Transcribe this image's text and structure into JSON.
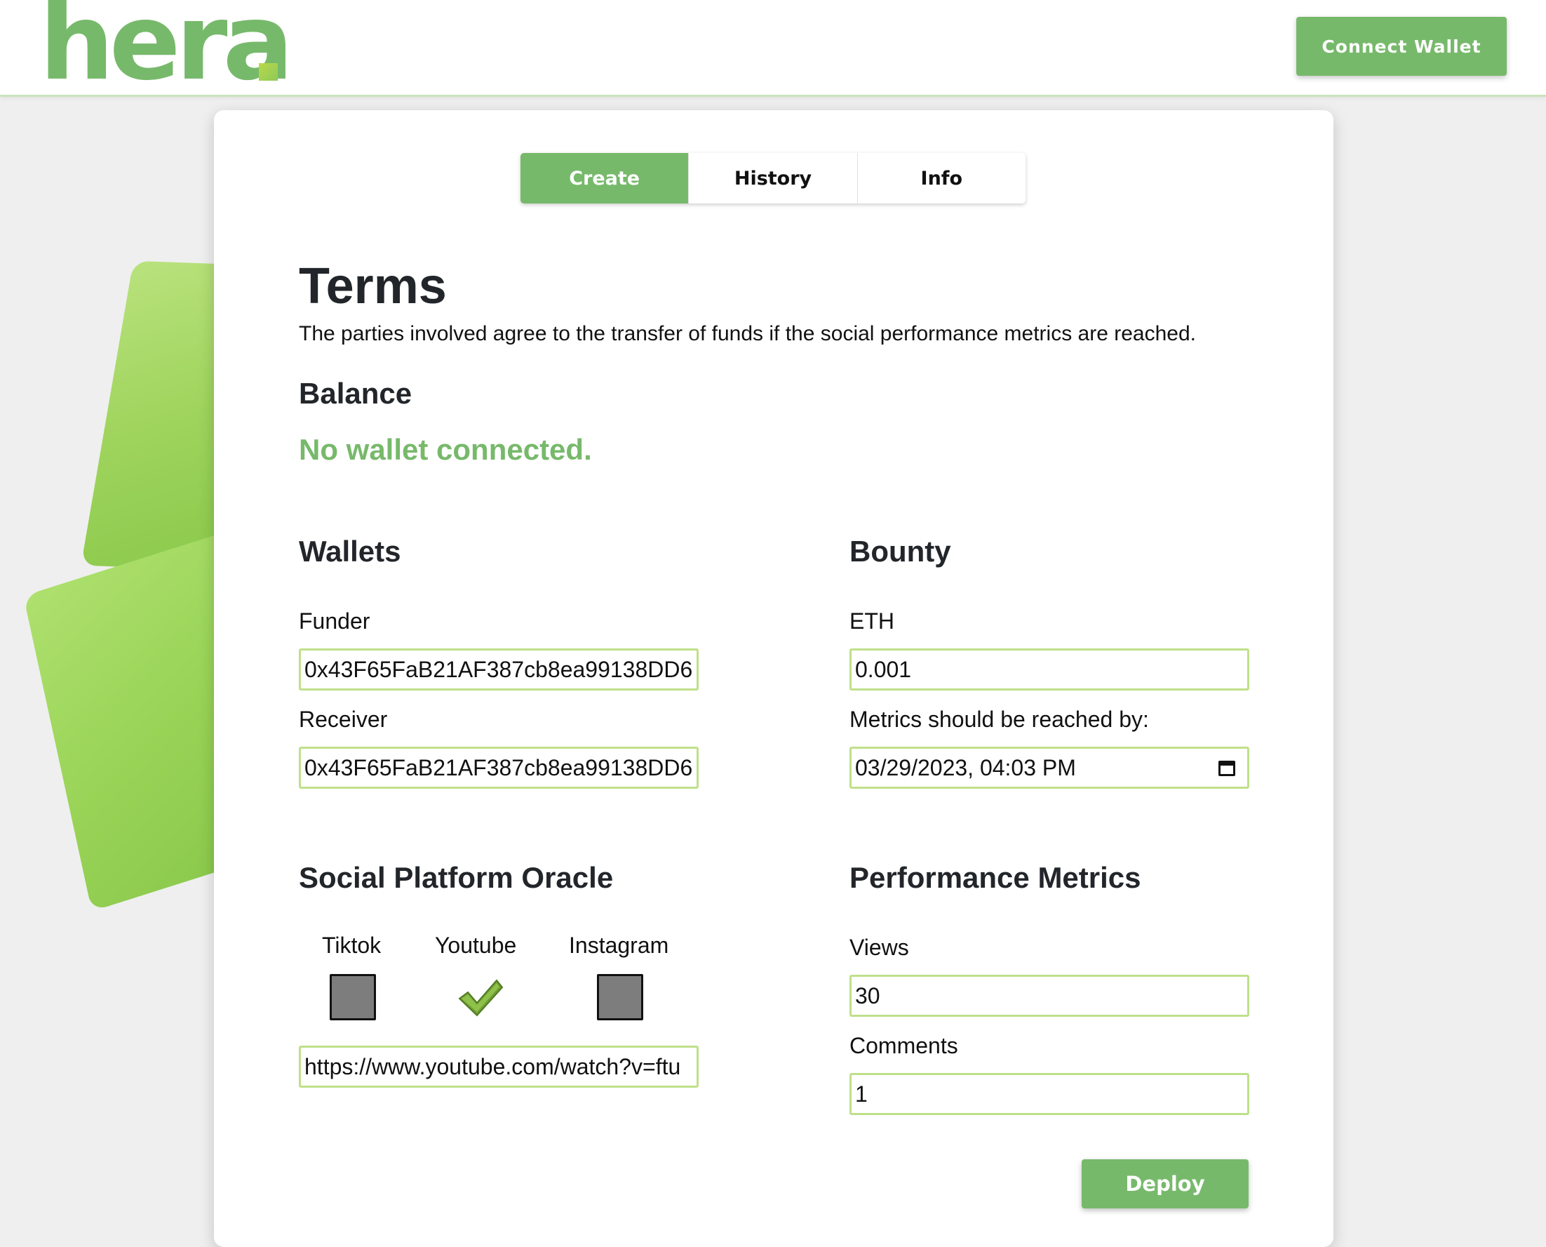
{
  "header": {
    "logo_text": "hera",
    "connect_button_label": "Connect Wallet"
  },
  "tabs": [
    {
      "label": "Create",
      "active": true
    },
    {
      "label": "History",
      "active": false
    },
    {
      "label": "Info",
      "active": false
    }
  ],
  "terms": {
    "title": "Terms",
    "description": "The parties involved agree to the transfer of funds if the social performance metrics are reached."
  },
  "balance": {
    "title": "Balance",
    "status": "No wallet connected."
  },
  "wallets": {
    "title": "Wallets",
    "funder_label": "Funder",
    "funder_value": "0x43F65FaB21AF387cb8ea99138DD6",
    "receiver_label": "Receiver",
    "receiver_value": "0x43F65FaB21AF387cb8ea99138DD6"
  },
  "bounty": {
    "title": "Bounty",
    "eth_label": "ETH",
    "eth_value": "0.001",
    "deadline_label": "Metrics should be reached by:",
    "deadline_value": "03/29/2023, 04:03 PM"
  },
  "oracle": {
    "title": "Social Platform Oracle",
    "platforms": [
      {
        "label": "Tiktok",
        "checked": false
      },
      {
        "label": "Youtube",
        "checked": true
      },
      {
        "label": "Instagram",
        "checked": false
      }
    ],
    "url_value": "https://www.youtube.com/watch?v=ftu"
  },
  "metrics": {
    "title": "Performance Metrics",
    "views_label": "Views",
    "views_value": "30",
    "comments_label": "Comments",
    "comments_value": "1"
  },
  "deploy_button_label": "Deploy",
  "colors": {
    "accent": "#77b96b",
    "field_border": "#bfe08a"
  }
}
